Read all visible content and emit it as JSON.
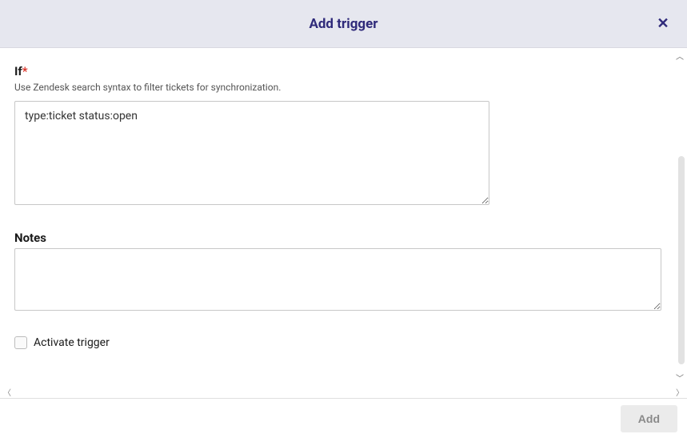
{
  "header": {
    "title": "Add trigger"
  },
  "form": {
    "if": {
      "label": "If",
      "required_mark": "*",
      "hint": "Use Zendesk search syntax to filter tickets for synchronization.",
      "value": "type:ticket status:open"
    },
    "notes": {
      "label": "Notes",
      "value": ""
    },
    "activate": {
      "label": "Activate trigger",
      "checked": false
    }
  },
  "footer": {
    "submit_label": "Add"
  }
}
